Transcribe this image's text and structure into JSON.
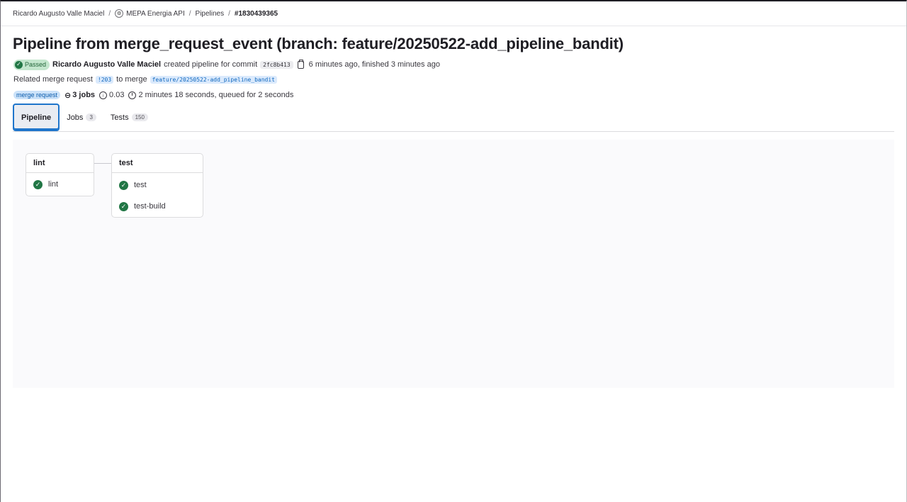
{
  "breadcrumb": {
    "owner": "Ricardo Augusto Valle Maciel",
    "project": "MEPA Energia API",
    "section": "Pipelines",
    "current": "#1830439365",
    "separator": "/"
  },
  "pipeline": {
    "title": "Pipeline from merge_request_event (branch: feature/20250522-add_pipeline_bandit)",
    "status": "Passed",
    "author": "Ricardo Augusto Valle Maciel",
    "created_text": "created pipeline for commit",
    "commit_sha": "2fc8b413",
    "timing": "6 minutes ago, finished 3 minutes ago",
    "related_prefix": "Related merge request",
    "mr_ref": "!203",
    "merge_to_text": "to merge",
    "branch": "feature/20250522-add_pipeline_bandit",
    "source_badge": "merge request",
    "jobs_count": "3 jobs",
    "compute": "0.03",
    "duration": "2 minutes 18 seconds, queued for 2 seconds"
  },
  "tabs": [
    {
      "label": "Pipeline",
      "count": null
    },
    {
      "label": "Jobs",
      "count": "3"
    },
    {
      "label": "Tests",
      "count": "150"
    }
  ],
  "stages": [
    {
      "name": "lint",
      "jobs": [
        {
          "name": "lint",
          "status": "success"
        }
      ]
    },
    {
      "name": "test",
      "jobs": [
        {
          "name": "test",
          "status": "success"
        },
        {
          "name": "test-build",
          "status": "success"
        }
      ]
    }
  ],
  "colors": {
    "success": "#217645",
    "active_tab_border": "#1f75cb",
    "link": "#1068bf"
  },
  "icons": {
    "success": "check-circle-icon",
    "clipboard": "clipboard-icon",
    "jobs": "pipeline-icon",
    "compute": "compute-icon",
    "duration": "timer-icon"
  }
}
